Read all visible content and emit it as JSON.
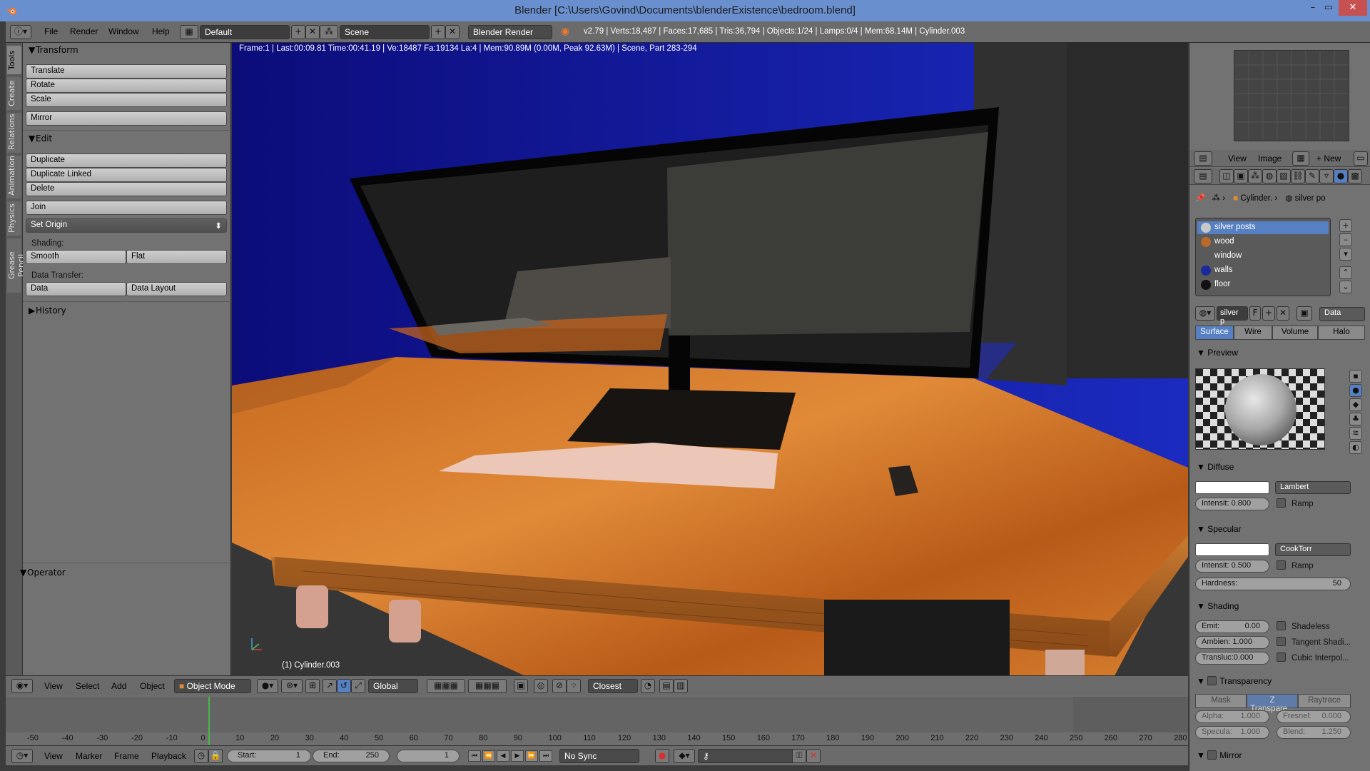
{
  "window": {
    "title": "Blender [C:\\Users\\Govind\\Documents\\blenderExistence\\bedroom.blend]",
    "controls": [
      "–",
      "▭",
      "✕"
    ]
  },
  "info_header": {
    "menus": [
      "File",
      "Render",
      "Window",
      "Help"
    ],
    "layout": "Default",
    "scene": "Scene",
    "engine": "Blender Render",
    "stats": "v2.79 | Verts:18,487 | Faces:17,685 | Tris:36,794 | Objects:1/24 | Lamps:0/4 | Mem:68.14M | Cylinder.003"
  },
  "left_tabs": [
    "Tools",
    "Create",
    "Relations",
    "Animation",
    "Physics",
    "Grease Pencil"
  ],
  "tool_panel": {
    "transform_title": "Transform",
    "transform_buttons": [
      "Translate",
      "Rotate",
      "Scale"
    ],
    "mirror": "Mirror",
    "edit_title": "Edit",
    "edit_buttons": [
      "Duplicate",
      "Duplicate Linked",
      "Delete"
    ],
    "join": "Join",
    "set_origin": "Set Origin",
    "shading_label": "Shading:",
    "smooth": "Smooth",
    "flat": "Flat",
    "data_transfer_label": "Data Transfer:",
    "data": "Data",
    "data_layout": "Data Layout",
    "history_title": "History",
    "operator_title": "Operator"
  },
  "viewport": {
    "info": "Frame:1 | Last:00:09.81 Time:00:41.19 | Ve:18487 Fa:19134 La:4 | Mem:90.89M (0.00M, Peak 92.63M) | Scene, Part 283-294",
    "object_label": "(1) Cylinder.003"
  },
  "properties": {
    "image_menus": [
      "View",
      "Image"
    ],
    "new_label": "New",
    "breadcrumb_object": "Cylinder.",
    "breadcrumb_material": "silver po",
    "materials": [
      {
        "name": "silver posts",
        "color": "#c8c8c8",
        "selected": true
      },
      {
        "name": "wood",
        "color": "#b86a2a",
        "selected": false
      },
      {
        "name": "window",
        "color": "",
        "selected": false
      },
      {
        "name": "walls",
        "color": "#1a2a9c",
        "selected": false
      },
      {
        "name": "floor",
        "color": "#111111",
        "selected": false
      }
    ],
    "material_name": "silver p",
    "fake_user": "F",
    "data_dropdown": "Data",
    "tabs": [
      "Surface",
      "Wire",
      "Volume",
      "Halo"
    ],
    "preview_title": "Preview",
    "diffuse_title": "Diffuse",
    "diffuse_shader": "Lambert",
    "diffuse_intensity": "Intensit: 0.800",
    "ramp": "Ramp",
    "specular_title": "Specular",
    "specular_shader": "CookTorr",
    "specular_intensity": "Intensit: 0.500",
    "hardness": "Hardness:",
    "hardness_value": "50",
    "shading_title": "Shading",
    "emit": "Emit:",
    "emit_value": "0.00",
    "ambient": "Ambien: 1.000",
    "translucency": "Transluc:0.000",
    "shadeless": "Shadeless",
    "tangent": "Tangent Shadi...",
    "cubic": "Cubic Interpol...",
    "transparency_title": "Transparency",
    "transp_tabs": [
      "Mask",
      "Z Transpare...",
      "Raytrace"
    ],
    "alpha": "Alpha:",
    "alpha_value": "1.000",
    "fresnel": "Fresnel:",
    "fresnel_value": "0.000",
    "specular_small": "Specula:",
    "specular_small_value": "1.000",
    "blend": "Blend:",
    "blend_value": "1.250",
    "mirror_title": "Mirror"
  },
  "view3d_header": {
    "menus": [
      "View",
      "Select",
      "Add",
      "Object"
    ],
    "mode": "Object Mode",
    "orientation": "Global",
    "snap": "Closest"
  },
  "timeline": {
    "ticks": [
      "-50",
      "-40",
      "-30",
      "-20",
      "-10",
      "0",
      "10",
      "20",
      "30",
      "40",
      "50",
      "60",
      "70",
      "80",
      "90",
      "100",
      "110",
      "120",
      "130",
      "140",
      "150",
      "160",
      "170",
      "180",
      "190",
      "200",
      "210",
      "220",
      "230",
      "240",
      "250",
      "260",
      "270",
      "280"
    ],
    "menus": [
      "View",
      "Marker",
      "Frame",
      "Playback"
    ],
    "start_label": "Start:",
    "start_value": "1",
    "end_label": "End:",
    "end_value": "250",
    "current_frame": "1",
    "sync": "No Sync"
  }
}
